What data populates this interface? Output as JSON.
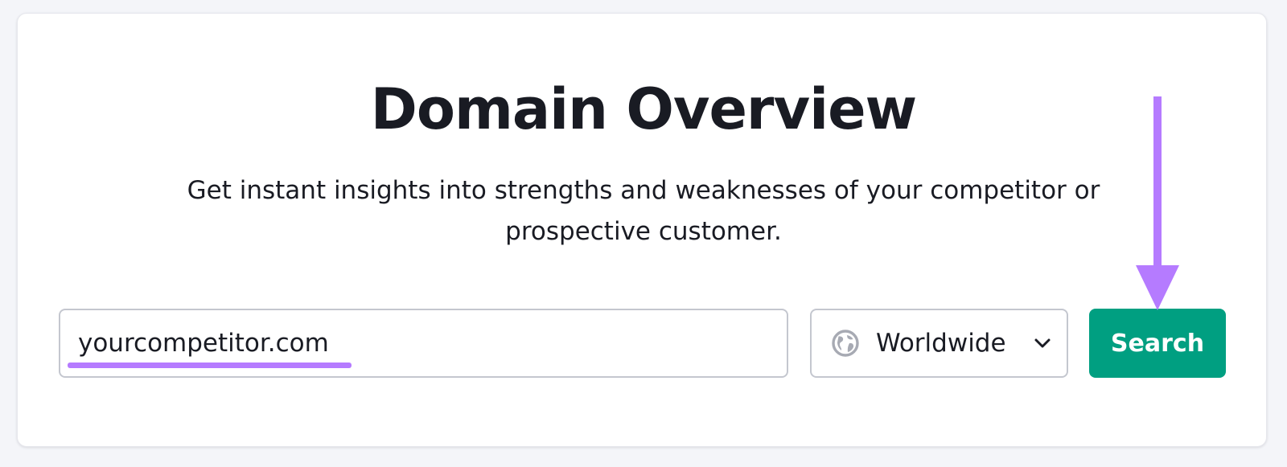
{
  "header": {
    "title": "Domain Overview",
    "subtitle": "Get instant insights into strengths and weaknesses of your competitor or prospective customer."
  },
  "search": {
    "domain_value": "yourcompetitor.com",
    "region": {
      "selected": "Worldwide",
      "icon": "globe-icon",
      "dropdown_icon": "chevron-down-icon"
    },
    "button_label": "Search"
  },
  "colors": {
    "page_background": "#f4f5f9",
    "card_background": "#ffffff",
    "text": "#191b23",
    "field_border": "#c4c7cf",
    "button_background": "#009f81",
    "button_text": "#ffffff",
    "annotation": "#b57bff",
    "globe_icon": "#a7aab3"
  }
}
